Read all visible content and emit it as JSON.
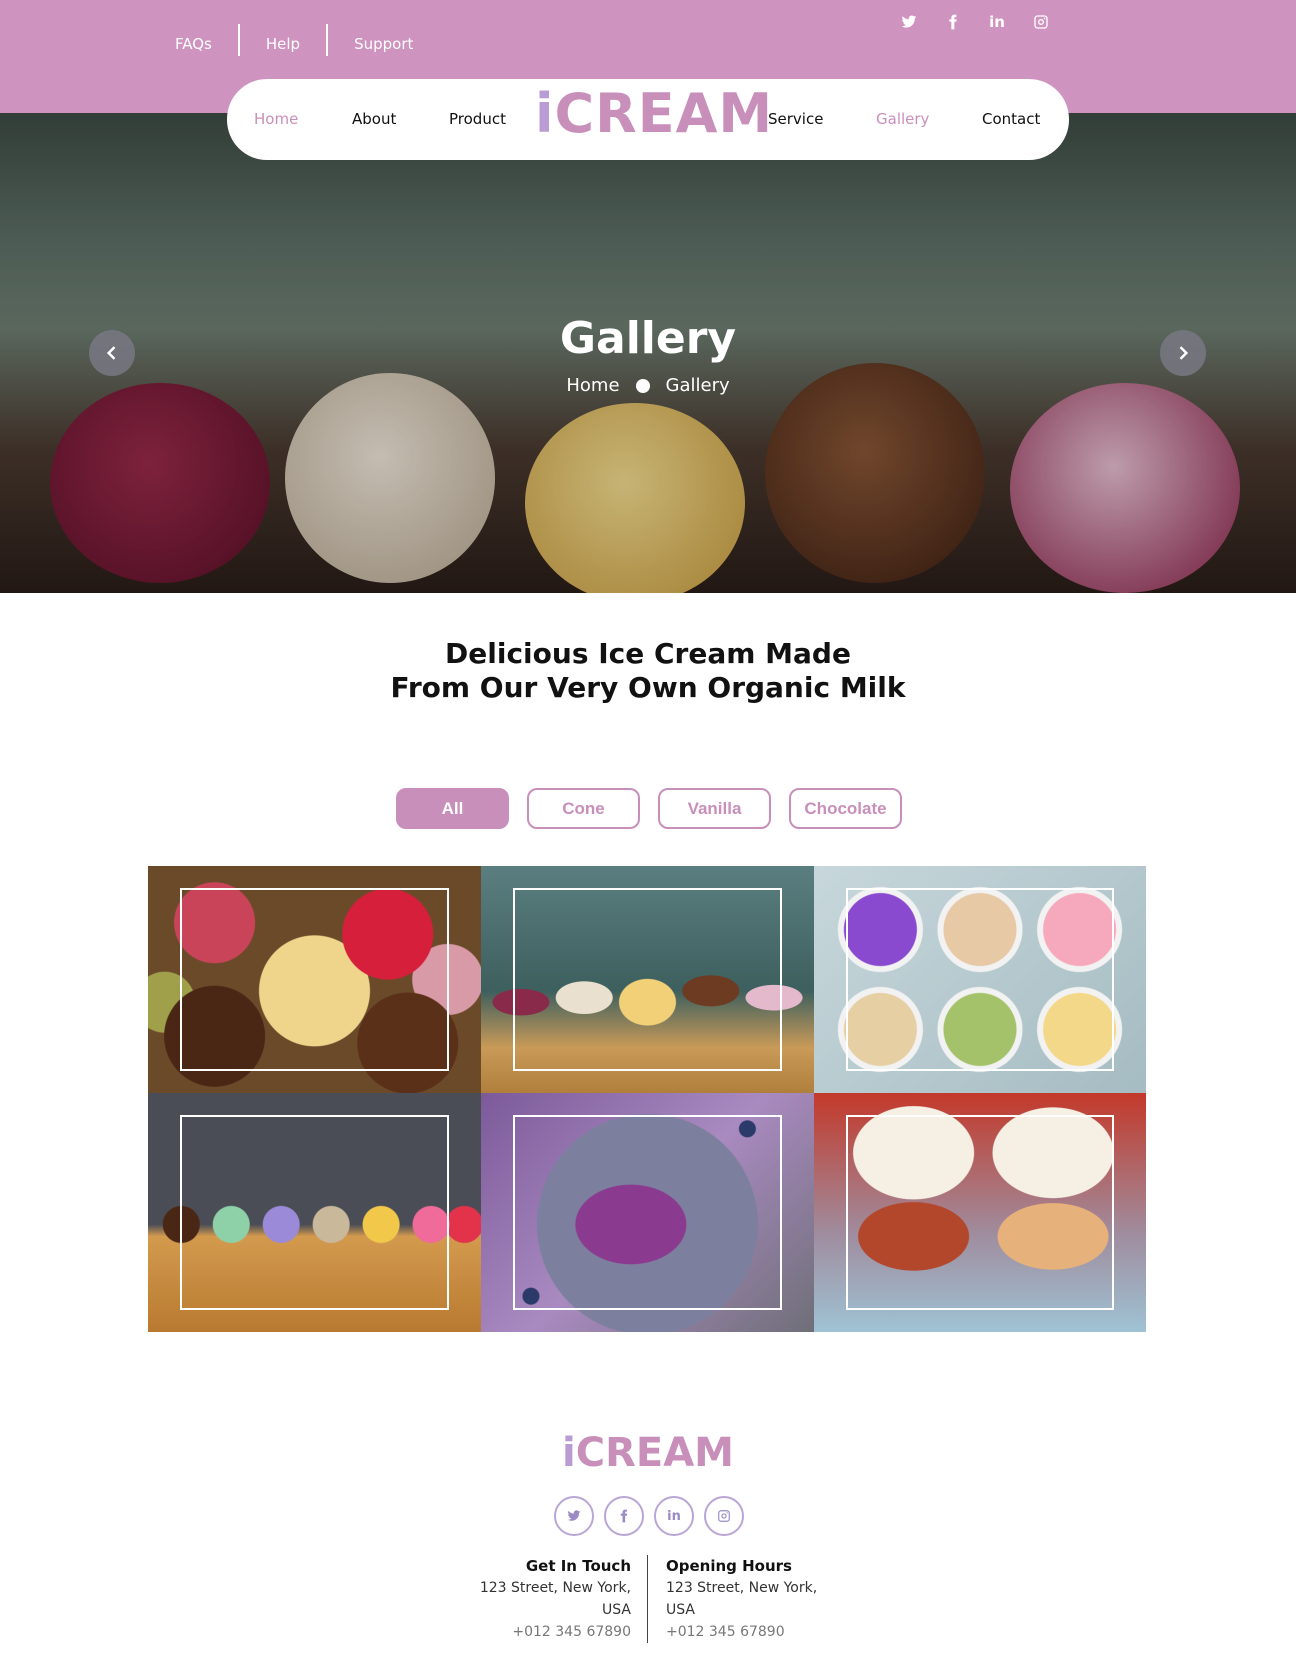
{
  "topbar": {
    "links": [
      "FAQs",
      "Help",
      "Support"
    ],
    "social_icons": [
      "twitter-icon",
      "facebook-icon",
      "linkedin-icon",
      "instagram-icon"
    ]
  },
  "nav": {
    "items": [
      "Home",
      "About",
      "Product",
      "Service",
      "Gallery",
      "Contact"
    ],
    "logo_i": "i",
    "logo_rest": "CREAM"
  },
  "hero": {
    "title": "Gallery",
    "breadcrumb_home": "Home",
    "breadcrumb_current": "Gallery"
  },
  "section": {
    "heading_line1": "Delicious Ice Cream Made",
    "heading_line2": "From Our Very Own Organic Milk"
  },
  "filters": [
    "All",
    "Cone",
    "Vanilla",
    "Chocolate"
  ],
  "footer": {
    "logo_i": "i",
    "logo_rest": "CREAM",
    "contact_title": "Get In Touch",
    "contact_address": "123 Street, New York, USA",
    "contact_phone": "+012 345 67890",
    "hours_title": "Opening Hours",
    "hours_address": "123 Street, New York, USA",
    "hours_phone": "+012 345 67890"
  },
  "colors": {
    "brand": "#c98fbb",
    "topbar": "#cf93bf",
    "accent_purple": "#b89cd3"
  }
}
